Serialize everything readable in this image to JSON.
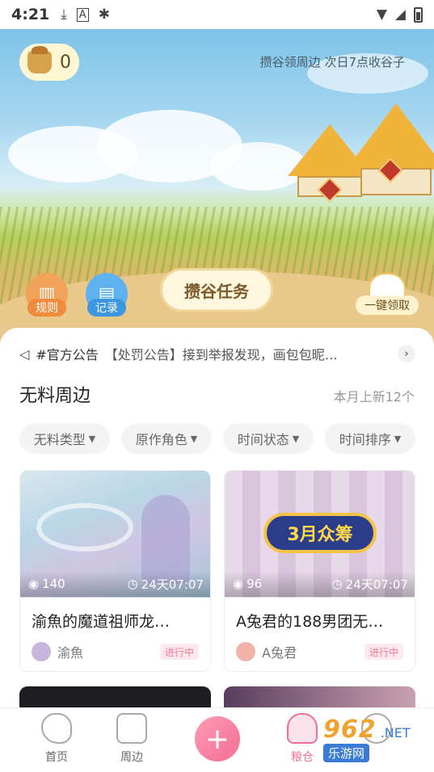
{
  "status_bar": {
    "time": "4:21",
    "left_icons": [
      "download-icon",
      "a-badge-icon",
      "bug-icon"
    ],
    "right_icons": [
      "wifi-icon",
      "signal-icon",
      "battery-icon"
    ]
  },
  "hero": {
    "coin_count": "0",
    "tip": "攒谷领周边 次日7点收谷子",
    "rules_label": "规则",
    "records_label": "记录",
    "task_button": "攒谷任务",
    "collect_label": "一键领取"
  },
  "notice": {
    "tag": "#官方公告",
    "message": "【处罚公告】接到举报发现，画包包昵…"
  },
  "section": {
    "title": "无料周边",
    "meta": "本月上新12个"
  },
  "filters": [
    "无料类型",
    "原作角色",
    "时间状态",
    "时间排序"
  ],
  "cards": [
    {
      "views": "140",
      "time_left": "24天07:07",
      "title": "渝魚的魔道祖师龙…",
      "author": "渝魚",
      "status": "进行中"
    },
    {
      "views": "96",
      "time_left": "24天07:07",
      "title": "A兔君的188男团无…",
      "author": "A兔君",
      "status": "进行中",
      "image_text": "3月众筹"
    }
  ],
  "bottom_nav": {
    "home": "首页",
    "merch": "周边",
    "add": "+",
    "granary": "粮仓",
    "profile": ""
  },
  "watermark": {
    "top": "962",
    "net": ".NET",
    "bottom": "乐游网"
  },
  "colors": {
    "accent": "#f26f93",
    "status_bg": "#ffe9ef",
    "status_text": "#f07a9a",
    "active_nav": "#f26f93"
  }
}
